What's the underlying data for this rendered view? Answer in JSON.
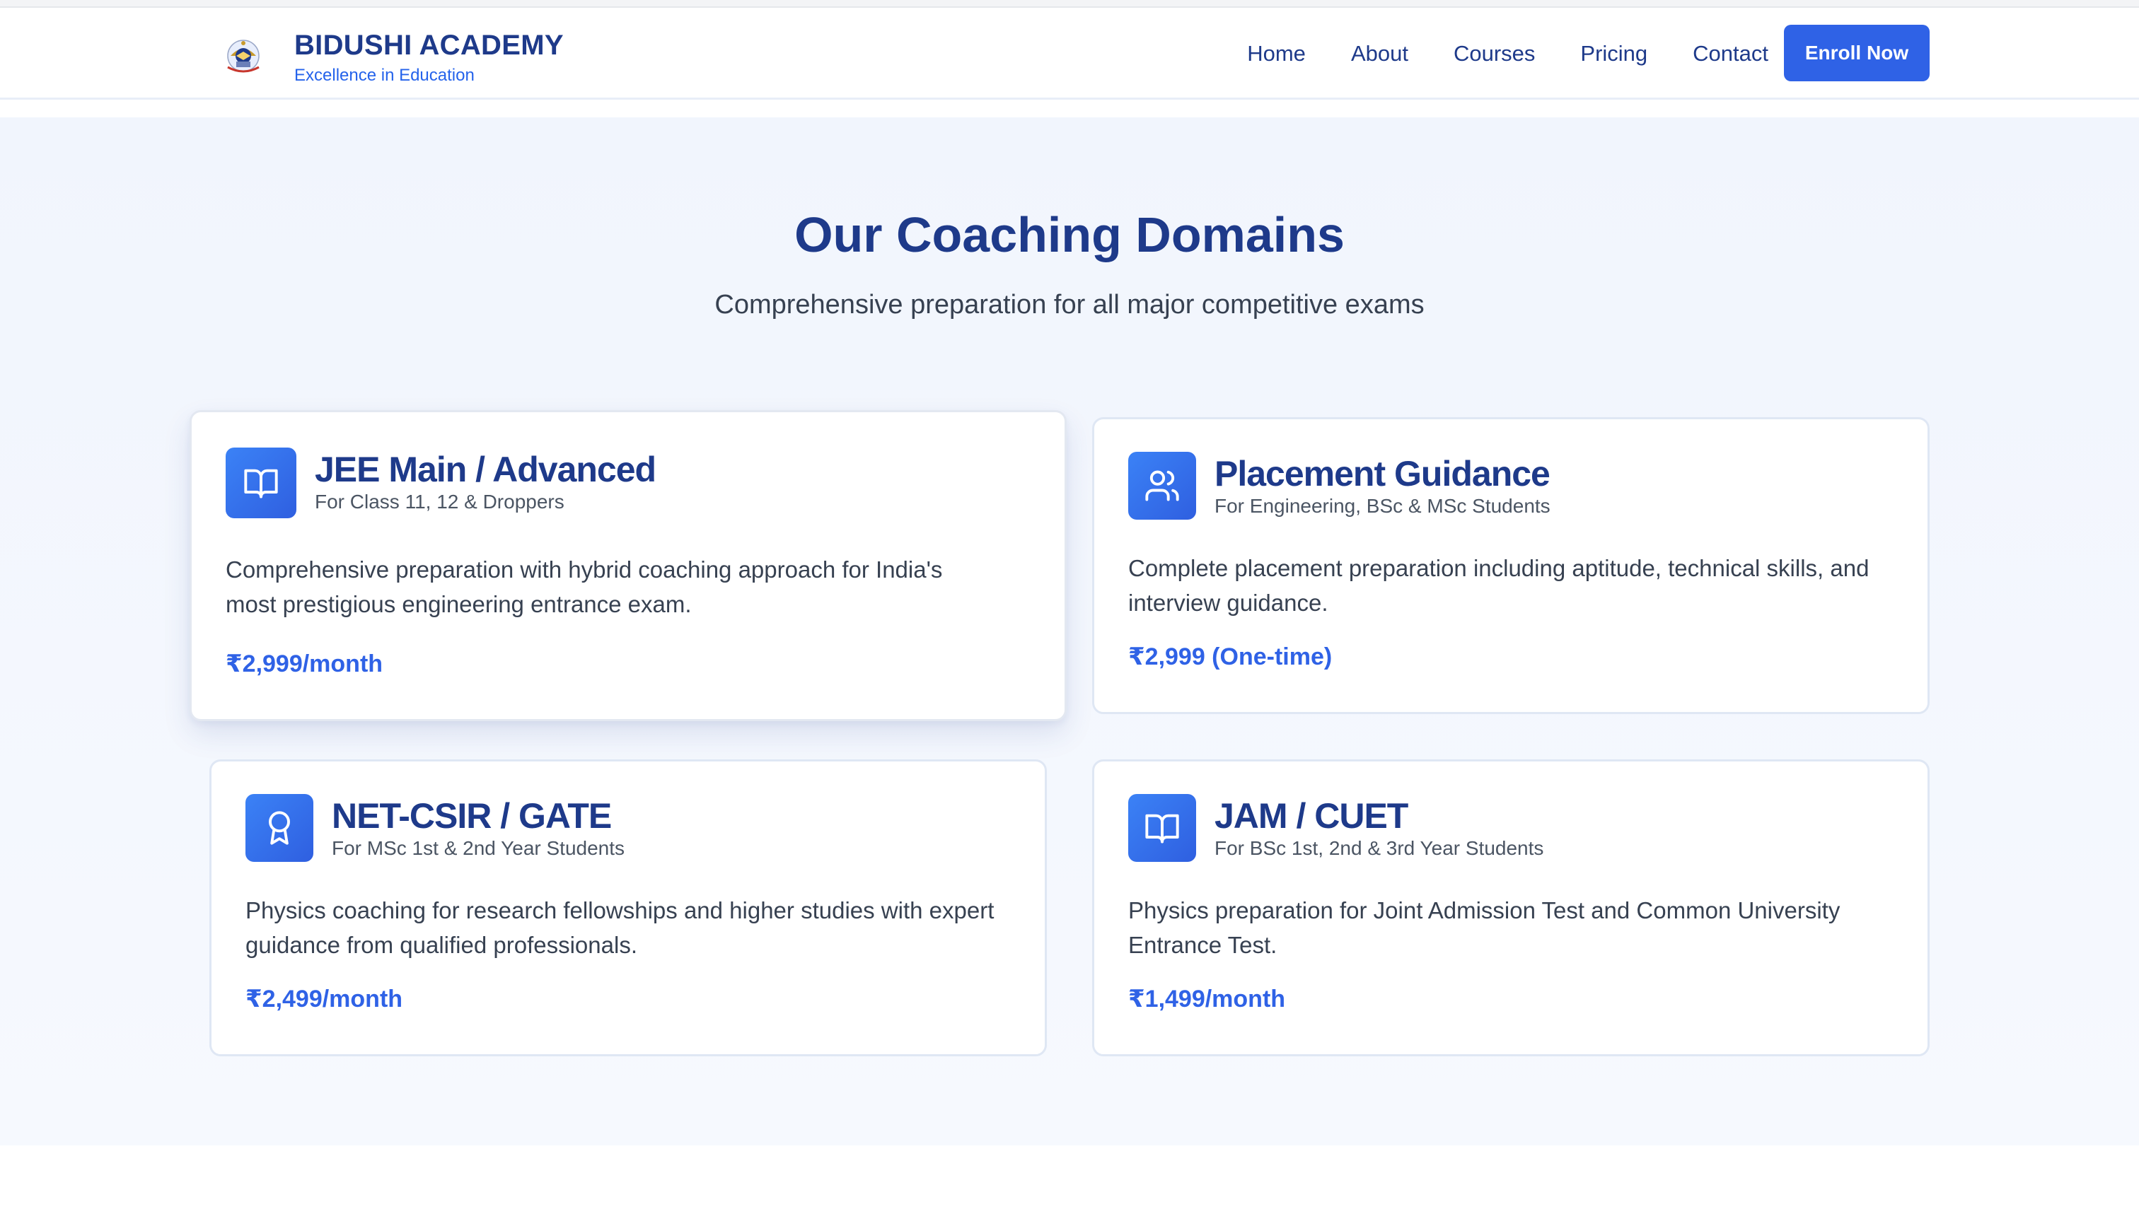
{
  "brand": {
    "name": "BIDUSHI ACADEMY",
    "tagline": "Excellence in Education"
  },
  "nav": {
    "links": [
      "Home",
      "About",
      "Courses",
      "Pricing",
      "Contact"
    ],
    "cta": "Enroll Now"
  },
  "section": {
    "title": "Our Coaching Domains",
    "subtitle": "Comprehensive preparation for all major competitive exams"
  },
  "cards": [
    {
      "icon": "book-open-icon",
      "title": "JEE Main / Advanced",
      "subtitle": "For Class 11, 12 & Droppers",
      "description_line1": "Comprehensive preparation with hybrid coaching approach for India's",
      "description_line2": "most prestigious engineering entrance exam.",
      "price": "₹2,999/month"
    },
    {
      "icon": "users-icon",
      "title": "Placement Guidance",
      "subtitle": "For Engineering, BSc & MSc Students",
      "description_line1": "Complete placement preparation including aptitude, technical skills, and",
      "description_line2": "interview guidance.",
      "price": "₹2,999 (One-time)"
    },
    {
      "icon": "award-icon",
      "title": "NET-CSIR / GATE",
      "subtitle": "For MSc 1st & 2nd Year Students",
      "description_line1": "Physics coaching for research fellowships and higher studies with expert",
      "description_line2": "guidance from qualified professionals.",
      "price": "₹2,499/month"
    },
    {
      "icon": "book-open-icon",
      "title": "JAM / CUET",
      "subtitle": "For BSc 1st, 2nd & 3rd Year Students",
      "description_line1": "Physics preparation for Joint Admission Test and Common University",
      "description_line2": "Entrance Test.",
      "price": "₹1,499/month"
    }
  ],
  "colors": {
    "primary": "#2f62e6",
    "heading": "#1e3a8a",
    "body_text": "#374151",
    "section_bg": "#f1f5fd"
  }
}
